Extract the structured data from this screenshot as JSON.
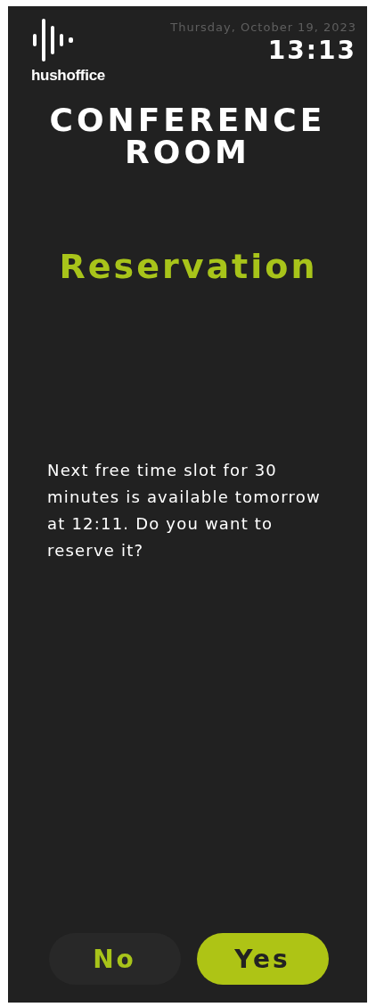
{
  "brand": {
    "name": "hushoffice"
  },
  "date": "Thursday, October 19, 2023",
  "time": "13:13",
  "room": "CONFERENCE ROOM",
  "heading": "Reservation",
  "message": "Next free time slot for 30 minutes is available tomorrow at 12:11. Do you want to reserve it?",
  "buttons": [
    {
      "label": "No",
      "kind": "secondary"
    },
    {
      "label": "Yes",
      "kind": "primary"
    }
  ]
}
